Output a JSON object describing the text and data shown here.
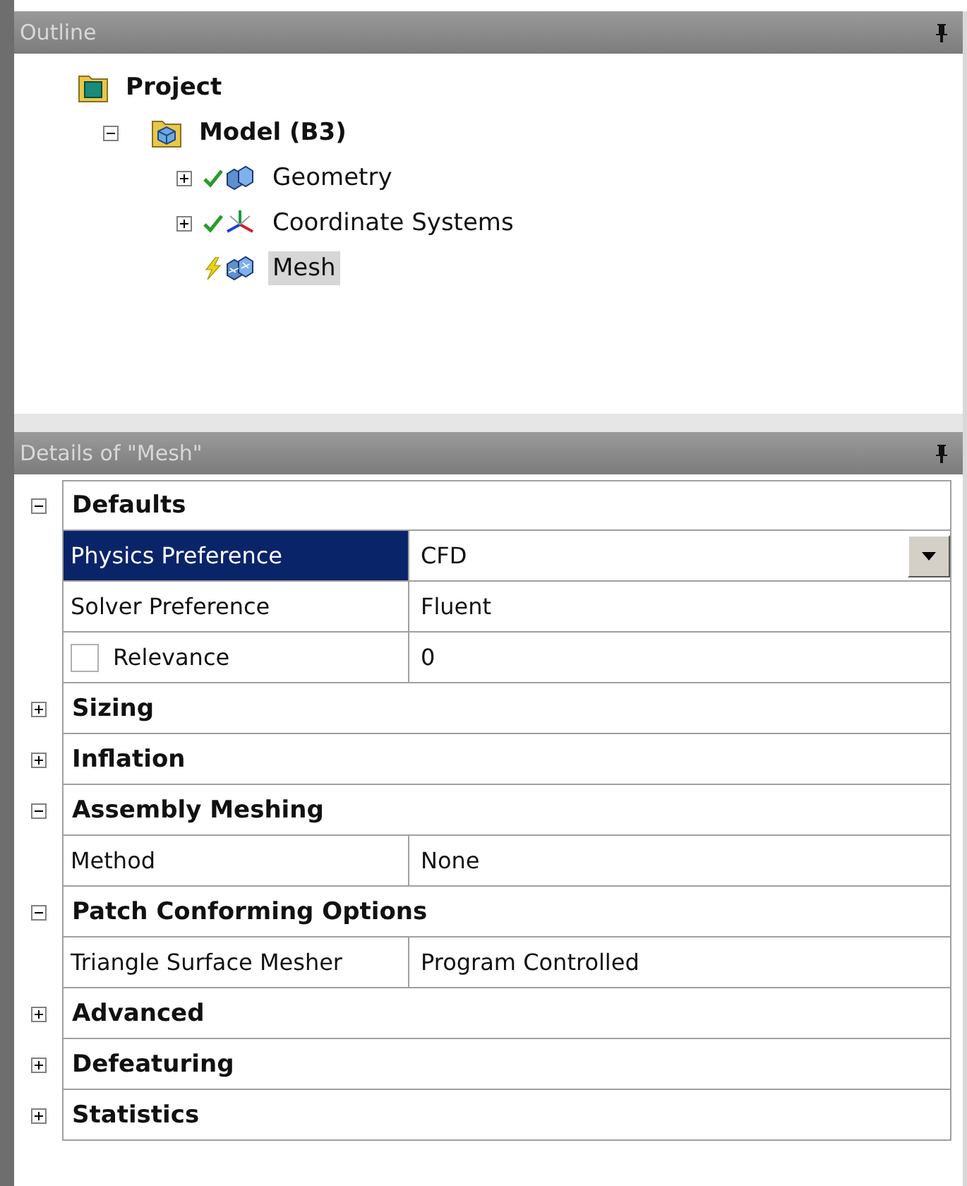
{
  "outline": {
    "title": "Outline",
    "tree": [
      {
        "label": "Project",
        "kind": "project",
        "bold": true,
        "selected": false,
        "children": [
          {
            "label": "Model (B3)",
            "kind": "model",
            "bold": true,
            "expanded": true,
            "selected": false,
            "children": [
              {
                "label": "Geometry",
                "kind": "geometry",
                "bold": false,
                "expanded": false,
                "up_to_date": true,
                "selected": false
              },
              {
                "label": "Coordinate Systems",
                "kind": "coordinates",
                "bold": false,
                "expanded": false,
                "up_to_date": true,
                "selected": false
              },
              {
                "label": "Mesh",
                "kind": "mesh",
                "bold": false,
                "up_to_date": false,
                "selected": true
              }
            ]
          }
        ]
      }
    ]
  },
  "details": {
    "title": "Details of \"Mesh\"",
    "sections": [
      {
        "title": "Defaults",
        "expanded": true,
        "rows": [
          {
            "kind": "dropdown",
            "label": "Physics Preference",
            "value": "CFD",
            "selected": true
          },
          {
            "kind": "text",
            "label": "Solver Preference",
            "value": "Fluent",
            "selected": false
          },
          {
            "kind": "checkbox",
            "label": "Relevance",
            "value": "0",
            "checked": false,
            "selected": false
          }
        ]
      },
      {
        "title": "Sizing",
        "expanded": false
      },
      {
        "title": "Inflation",
        "expanded": false
      },
      {
        "title": "Assembly Meshing",
        "expanded": true,
        "rows": [
          {
            "kind": "text",
            "label": "Method",
            "value": "None",
            "selected": false
          }
        ]
      },
      {
        "title": "Patch Conforming Options",
        "expanded": true,
        "rows": [
          {
            "kind": "text",
            "label": "Triangle Surface Mesher",
            "value": "Program Controlled",
            "selected": false
          }
        ]
      },
      {
        "title": "Advanced",
        "expanded": false
      },
      {
        "title": "Defeaturing",
        "expanded": false
      },
      {
        "title": "Statistics",
        "expanded": false
      }
    ]
  }
}
